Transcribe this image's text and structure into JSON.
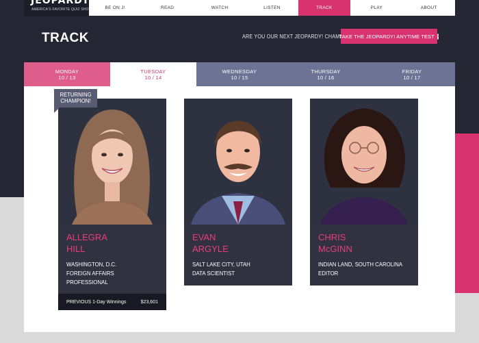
{
  "logo": {
    "main": "JEOPARDY!",
    "tagline": "AMERICA'S FAVORITE QUIZ SHOW"
  },
  "nav": {
    "items": [
      "BE ON J!",
      "READ",
      "WATCH",
      "LISTEN",
      "TRACK",
      "PLAY",
      "ABOUT"
    ],
    "active": "TRACK"
  },
  "page": {
    "title": "TRACK",
    "promo_text": "ARE YOU OUR NEXT JEOPARDY! CHAMPION?",
    "promo_button": "TAKE THE JEOPARDY! ANYTIME TEST"
  },
  "days": [
    {
      "day": "MONDAY",
      "date": "10 / 13"
    },
    {
      "day": "TUESDAY",
      "date": "10 / 14"
    },
    {
      "day": "WEDNESDAY",
      "date": "10 / 15"
    },
    {
      "day": "THURSDAY",
      "date": "10 / 16"
    },
    {
      "day": "FRIDAY",
      "date": "10 / 17"
    }
  ],
  "selected_day": "TUESDAY",
  "badge": {
    "line1": "RETURNING",
    "line2": "CHAMPION!"
  },
  "contestants": [
    {
      "first": "ALLEGRA",
      "last": "HILL",
      "location": "WASHINGTON, D.C.",
      "occupation_line1": "FOREIGN AFFAIRS",
      "occupation_line2": "PROFESSIONAL",
      "winnings_label": "PREVIOUS 1-Day Winnings",
      "winnings_value": "$23,601"
    },
    {
      "first": "EVAN",
      "last": "ARGYLE",
      "location": "SALT LAKE CITY, UTAH",
      "occupation_line1": "DATA SCIENTIST"
    },
    {
      "first": "CHRIS",
      "last": "McGINN",
      "location": "INDIAN LAND, SOUTH CAROLINA",
      "occupation_line1": "EDITOR"
    }
  ],
  "colors": {
    "brand_pink": "#d8336f",
    "dark_bg": "#242733",
    "card_bg": "#30323f",
    "slate_tab": "#6d7395"
  }
}
